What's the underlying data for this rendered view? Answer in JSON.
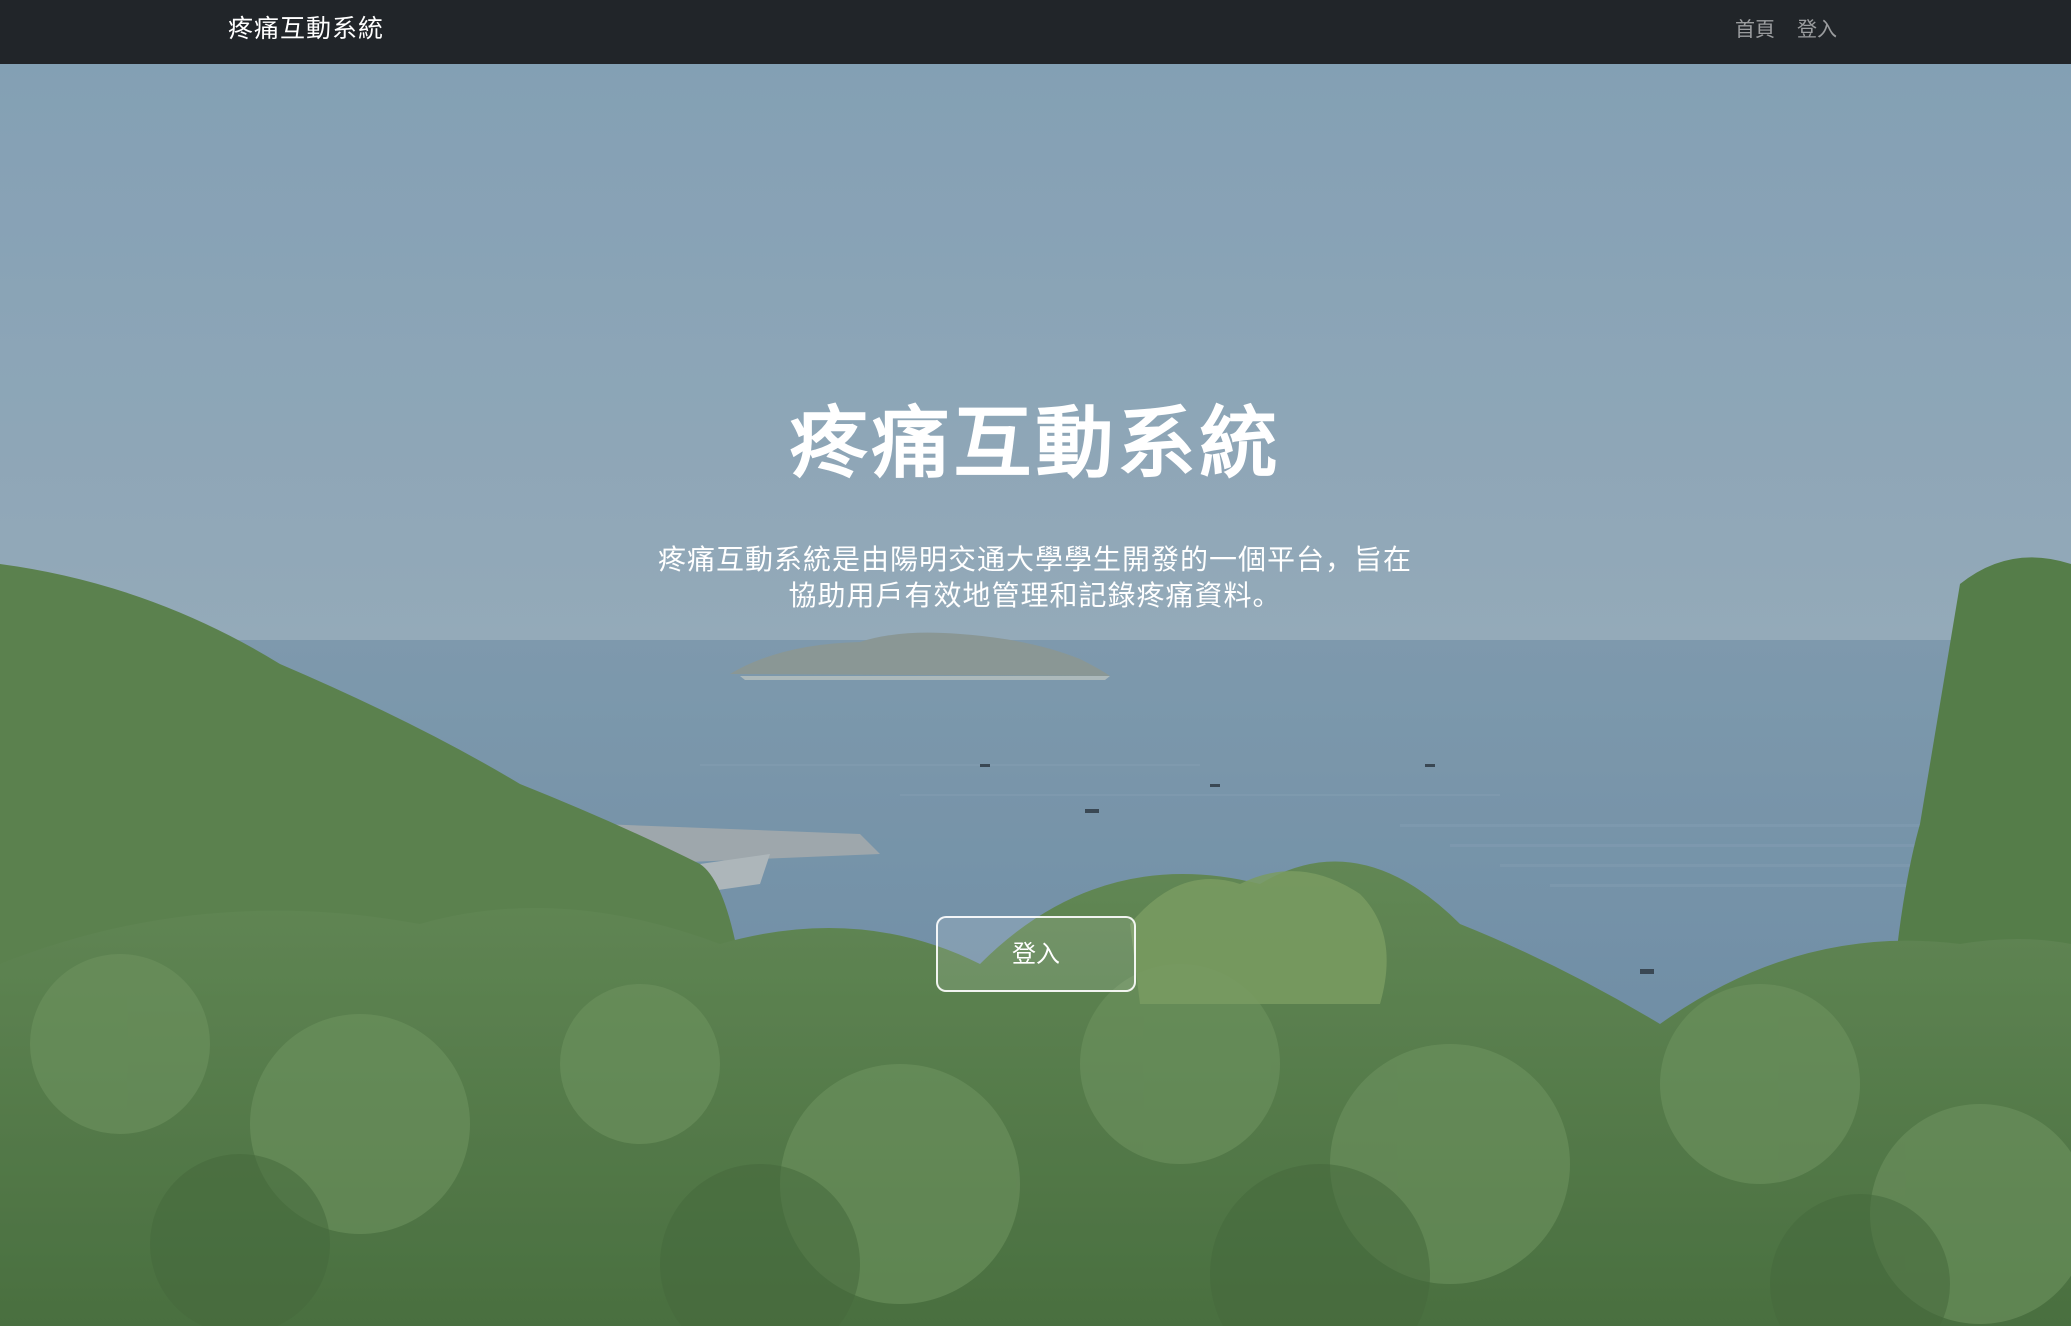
{
  "navbar": {
    "brand": "疼痛互動系統",
    "links": [
      {
        "label": "首頁"
      },
      {
        "label": "登入"
      }
    ]
  },
  "hero": {
    "title": "疼痛互動系統",
    "description": "疼痛互動系統是由陽明交通大學學生開發的一個平台，旨在協助用戶有效地管理和記錄疼痛資料。",
    "button_label": "登入"
  },
  "colors": {
    "navbar_bg": "#212529",
    "sky": "#8aa6b8",
    "sea": "#6f93ad",
    "forest": "#4f7a3a"
  }
}
